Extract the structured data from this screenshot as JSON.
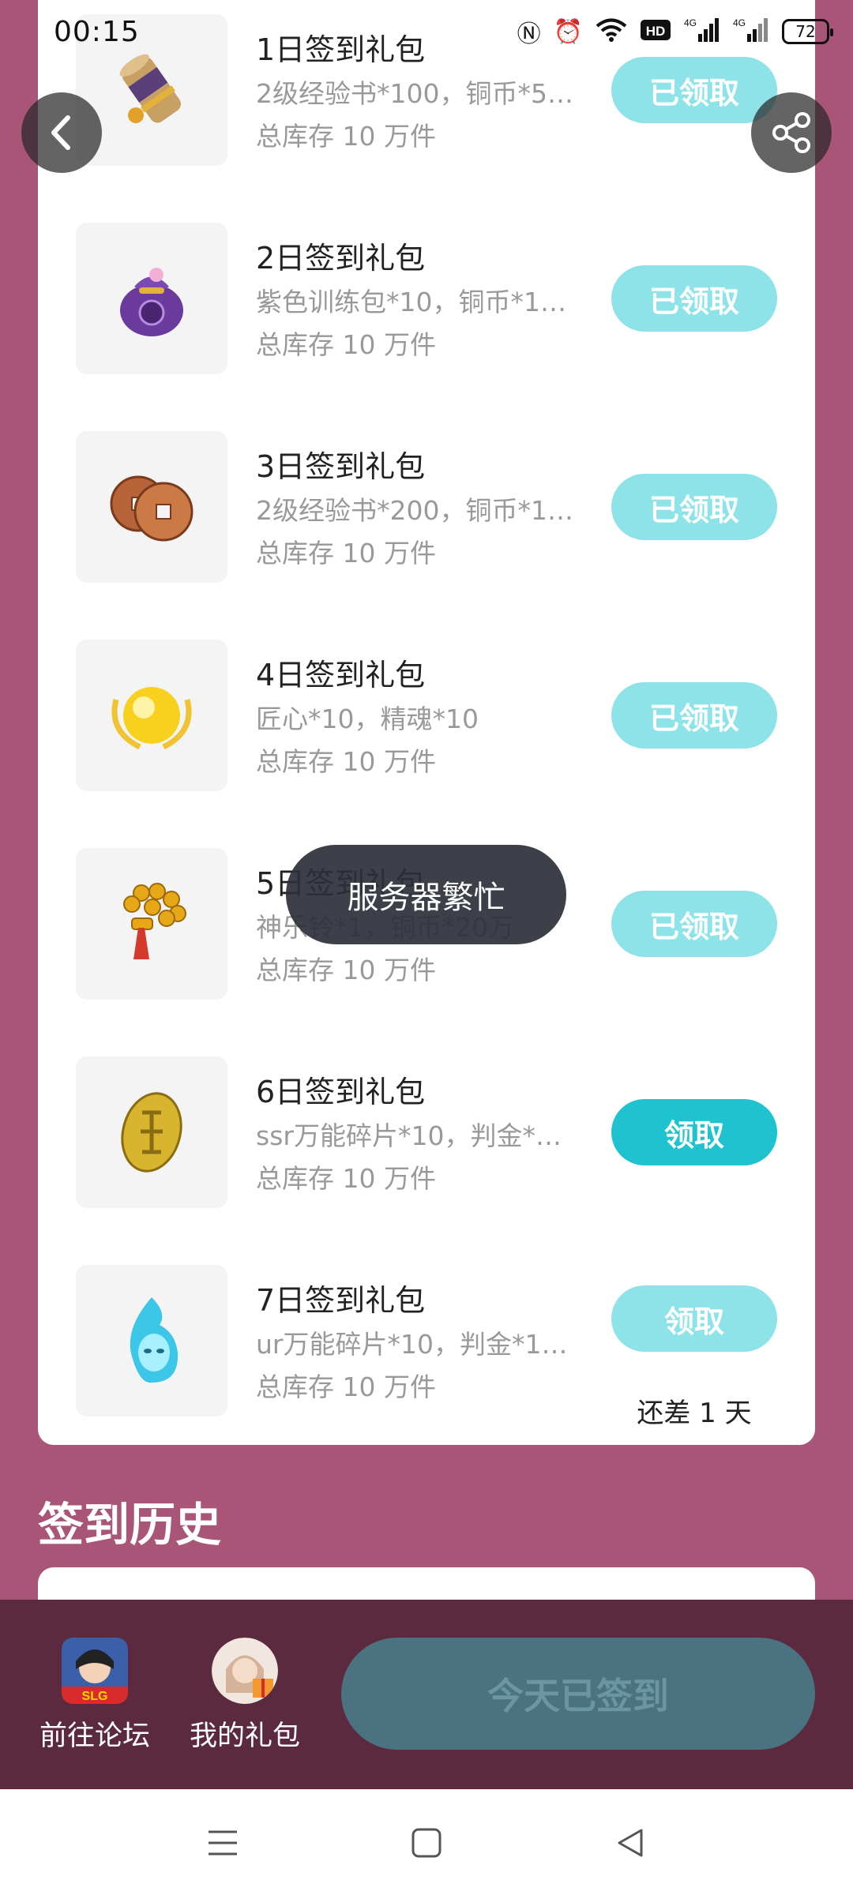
{
  "status": {
    "time": "00:15",
    "battery": "72",
    "icons": [
      "nfc-icon",
      "alarm-icon",
      "wifi-icon",
      "hd-icon",
      "signal-4g-icon",
      "signal-4g-icon"
    ]
  },
  "rewards": [
    {
      "title": "1日签到礼包",
      "desc": "2级经验书*100，铜币*5…",
      "stock": "总库存 10 万件",
      "button": "已领取",
      "state": "claimed",
      "icon": "scroll-icon"
    },
    {
      "title": "2日签到礼包",
      "desc": "紫色训练包*10，铜币*1…",
      "stock": "总库存 10 万件",
      "button": "已领取",
      "state": "claimed",
      "icon": "purple-bag-icon"
    },
    {
      "title": "3日签到礼包",
      "desc": "2级经验书*200，铜币*1…",
      "stock": "总库存 10 万件",
      "button": "已领取",
      "state": "claimed",
      "icon": "copper-coins-icon"
    },
    {
      "title": "4日签到礼包",
      "desc": "匠心*10，精魂*10",
      "stock": "总库存 10 万件",
      "button": "已领取",
      "state": "claimed",
      "icon": "golden-orb-icon"
    },
    {
      "title": "5日签到礼包",
      "desc": "神乐铃*1，铜币*20万",
      "stock": "总库存 10 万件",
      "button": "已领取",
      "state": "claimed",
      "icon": "kagura-bell-icon"
    },
    {
      "title": "6日签到礼包",
      "desc": "ssr万能碎片*10，判金*…",
      "stock": "总库存 10 万件",
      "button": "领取",
      "state": "active",
      "icon": "gold-koban-icon"
    },
    {
      "title": "7日签到礼包",
      "desc": "ur万能碎片*10，判金*1…",
      "stock": "总库存 10 万件",
      "button": "领取",
      "state": "locked",
      "icon": "blue-flame-icon",
      "remain": "还差 1 天"
    }
  ],
  "toast": "服务器繁忙",
  "history_title": "签到历史",
  "bottom": {
    "forum_label": "前往论坛",
    "forum_badge": "SLG",
    "gift_label": "我的礼包",
    "signed_label": "今天已签到"
  },
  "colors": {
    "background": "#a85577",
    "bottom_bar": "#5b2a3f",
    "claimed_button": "#8ee3e9",
    "active_button": "#1ec3cf",
    "signed_button": "#4a7280"
  }
}
